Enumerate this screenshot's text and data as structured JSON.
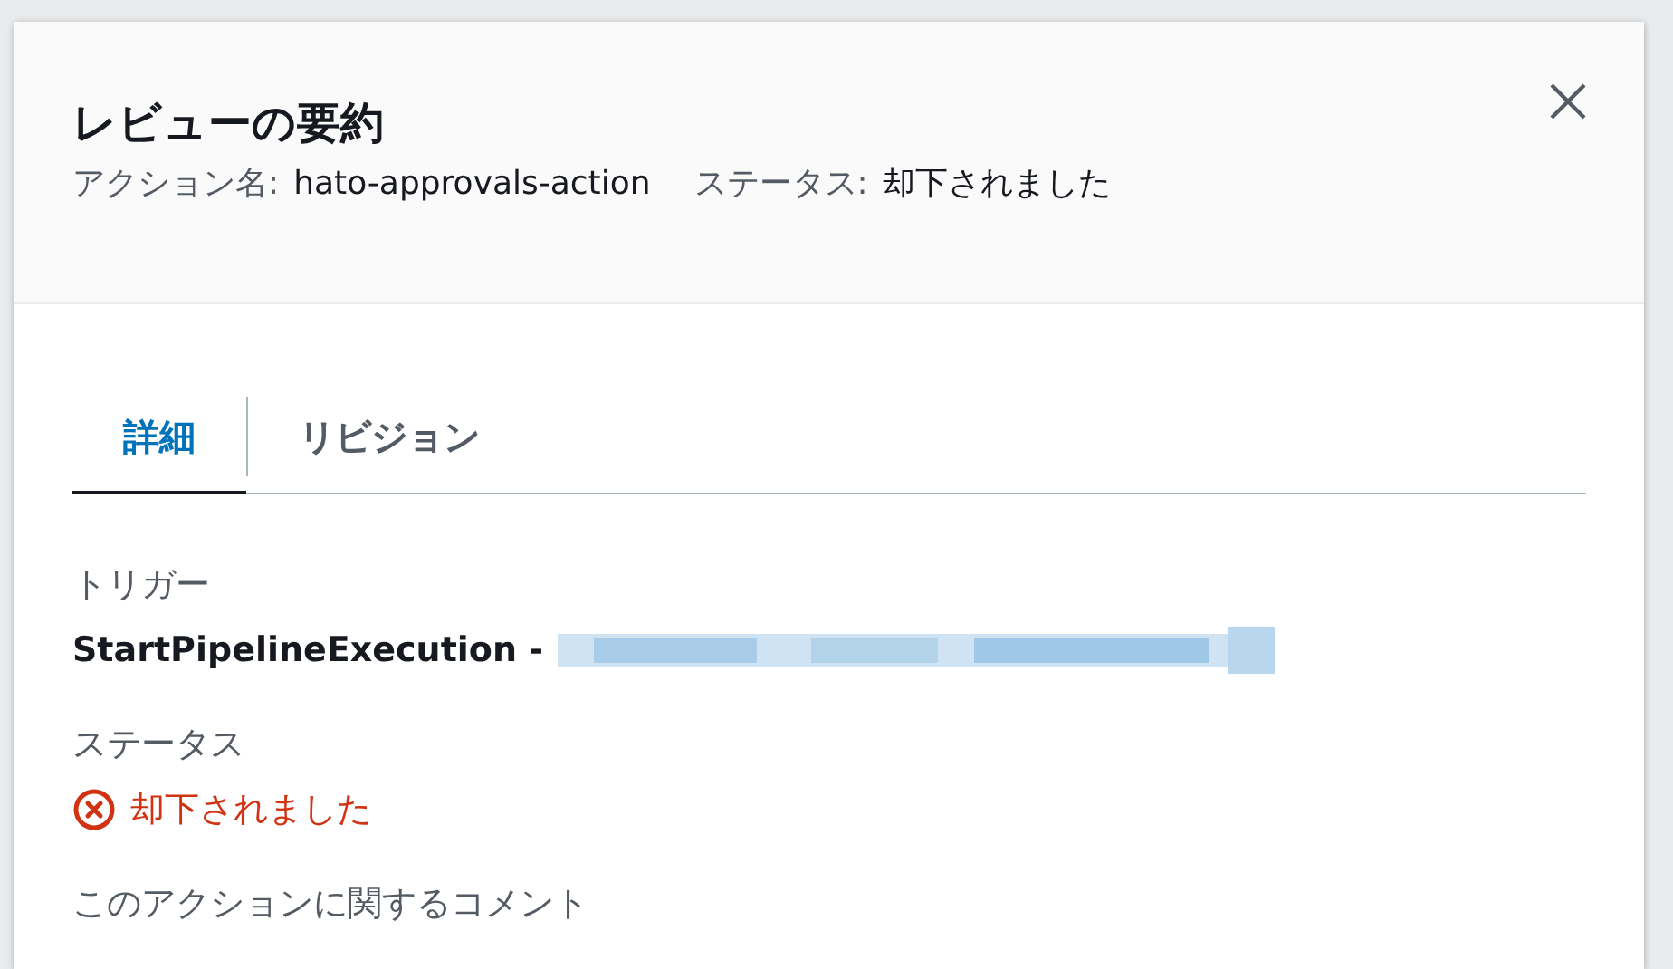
{
  "modal": {
    "title": "レビューの要約",
    "action_label": "アクション名:",
    "action_value": "hato-approvals-action",
    "status_label": "ステータス:",
    "status_value": "却下されました"
  },
  "tabs": [
    {
      "label": "詳細",
      "selected": true
    },
    {
      "label": "リビジョン",
      "selected": false
    }
  ],
  "fields": [
    {
      "label": "トリガー",
      "kind": "trigger",
      "value": "StartPipelineExecution -"
    },
    {
      "label": "ステータス",
      "kind": "status",
      "rejected": true,
      "value": "却下されました"
    },
    {
      "label": "このアクションに関するコメント",
      "kind": "heading"
    }
  ]
}
